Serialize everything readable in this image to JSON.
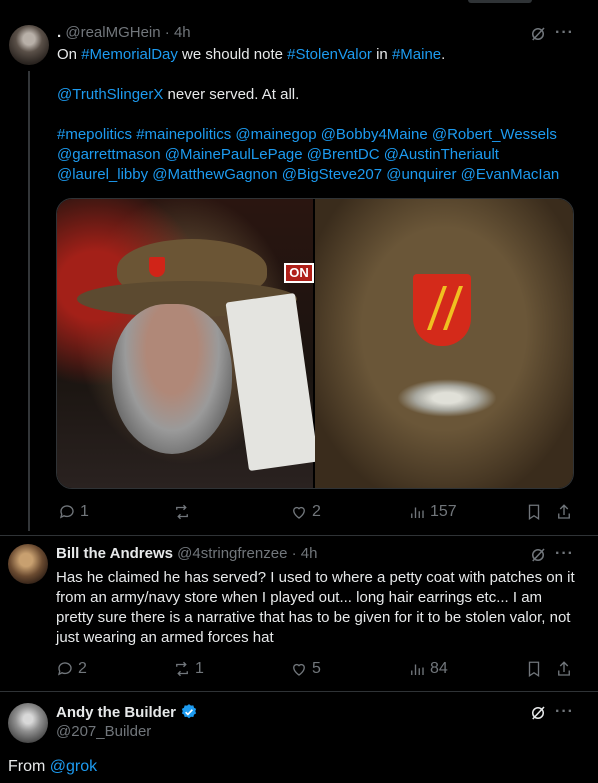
{
  "tweet1": {
    "dot": ".",
    "handle": "@realMGHein",
    "separator": "·",
    "time": "4h",
    "line1_pre": "On ",
    "line1_tag1": "#MemorialDay",
    "line1_mid": " we should note ",
    "line1_tag2": "#StolenValor",
    "line1_in": " in ",
    "line1_tag3": "#Maine",
    "line1_end": ".",
    "line2_mention": "@TruthSlingerX",
    "line2_text": " never served. At all.",
    "tags": [
      "#mepolitics",
      "#mainepolitics",
      "@mainegop",
      "@Bobby4Maine",
      "@Robert_Wessels",
      "@garrettmason",
      "@MainePaulLePage",
      "@BrentDC",
      "@AustinTheriault",
      "@laurel_libby",
      "@MatthewGagnon",
      "@BigSteve207",
      "@unquirer",
      "@EvanMacIan"
    ],
    "media_sign": "ON",
    "replies": "1",
    "reposts": "",
    "likes": "2",
    "views": "157"
  },
  "tweet2": {
    "name": "Bill the Andrews",
    "handle": "@4stringfrenzee",
    "separator": "·",
    "time": "4h",
    "text": "Has he claimed he has served? I used to where a petty coat with patches on it from an army/navy store when I played out... long hair earrings etc... I am pretty sure there is a narrative that has to be given for it to be stolen valor, not just wearing an armed forces hat",
    "replies": "2",
    "reposts": "1",
    "likes": "5",
    "views": "84"
  },
  "tweet3": {
    "name": "Andy the Builder",
    "handle": "@207_Builder",
    "body_pre": "From ",
    "body_mention": "@grok"
  },
  "colors": {
    "accent": "#1d9bf0",
    "muted": "#71767b",
    "text": "#e7e9ea",
    "background": "#000000"
  }
}
